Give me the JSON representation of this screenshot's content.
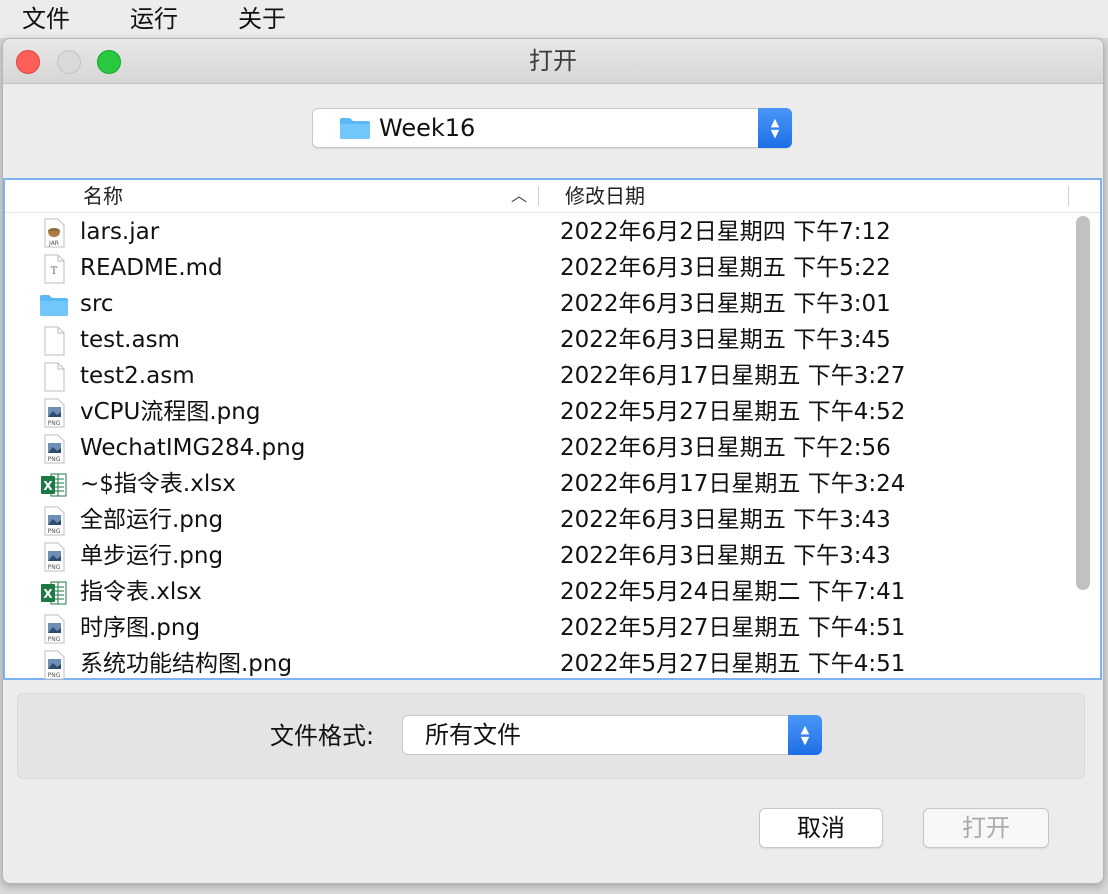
{
  "menubar": {
    "items": [
      "文件",
      "运行",
      "关于"
    ]
  },
  "dialog": {
    "title": "打开",
    "location": {
      "label": "Week16"
    },
    "columns": {
      "name": "名称",
      "date": "修改日期"
    },
    "files": [
      {
        "name": "lars.jar",
        "date": "2022年6月2日星期四 下午7:12",
        "icon": "jar-file-icon"
      },
      {
        "name": "README.md",
        "date": "2022年6月3日星期五 下午5:22",
        "icon": "text-file-icon"
      },
      {
        "name": "src",
        "date": "2022年6月3日星期五 下午3:01",
        "icon": "folder-icon"
      },
      {
        "name": "test.asm",
        "date": "2022年6月3日星期五 下午3:45",
        "icon": "blank-file-icon"
      },
      {
        "name": "test2.asm",
        "date": "2022年6月17日星期五 下午3:27",
        "icon": "blank-file-icon"
      },
      {
        "name": "vCPU流程图.png",
        "date": "2022年5月27日星期五 下午4:52",
        "icon": "png-file-icon"
      },
      {
        "name": "WechatIMG284.png",
        "date": "2022年6月3日星期五 下午2:56",
        "icon": "png-file-icon"
      },
      {
        "name": "~$指令表.xlsx",
        "date": "2022年6月17日星期五 下午3:24",
        "icon": "excel-file-icon"
      },
      {
        "name": "全部运行.png",
        "date": "2022年6月3日星期五 下午3:43",
        "icon": "png-file-icon"
      },
      {
        "name": "单步运行.png",
        "date": "2022年6月3日星期五 下午3:43",
        "icon": "png-file-icon"
      },
      {
        "name": "指令表.xlsx",
        "date": "2022年5月24日星期二 下午7:41",
        "icon": "excel-file-icon"
      },
      {
        "name": "时序图.png",
        "date": "2022年5月27日星期五 下午4:51",
        "icon": "png-file-icon"
      },
      {
        "name": "系统功能结构图.png",
        "date": "2022年5月27日星期五 下午4:51",
        "icon": "png-file-icon"
      }
    ],
    "format": {
      "label": "文件格式:",
      "value": "所有文件"
    },
    "buttons": {
      "cancel": "取消",
      "open": "打开"
    }
  },
  "colors": {
    "accent": "#1d6fe6",
    "folder": "#5ab8f5",
    "excel": "#1e7a45",
    "close": "#fe5f57",
    "maximize": "#28c840"
  }
}
